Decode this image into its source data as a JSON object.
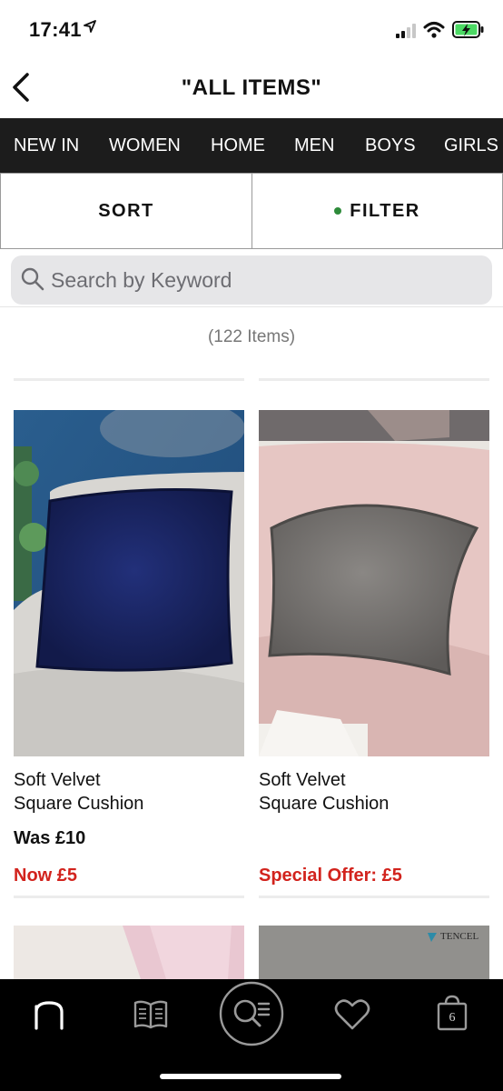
{
  "status_bar": {
    "time": "17:41"
  },
  "header": {
    "title": "\"ALL ITEMS\""
  },
  "categories": [
    "NEW IN",
    "WOMEN",
    "HOME",
    "MEN",
    "BOYS",
    "GIRLS"
  ],
  "toolbar": {
    "sort_label": "SORT",
    "filter_label": "FILTER"
  },
  "search": {
    "placeholder": "Search by Keyword"
  },
  "results": {
    "count_text": "(122 Items)"
  },
  "products": [
    {
      "name_line1": "Soft Velvet",
      "name_line2": "Square Cushion",
      "was_price": "Was £10",
      "price": "Now £5"
    },
    {
      "name_line1": "Soft Velvet",
      "name_line2": "Square Cushion",
      "price": "Special Offer: £5"
    }
  ],
  "next_products": [
    {
      "badge": "TENCEL"
    }
  ],
  "tab_bar": {
    "bag_count": "6",
    "tabs": [
      "home-logo-icon",
      "catalogue-icon",
      "search-list-icon",
      "heart-icon",
      "bag-icon"
    ]
  },
  "colors": {
    "accent_red": "#d2231d",
    "nav_background": "#1c1c1c",
    "filter_dot": "#2e8b3a"
  }
}
